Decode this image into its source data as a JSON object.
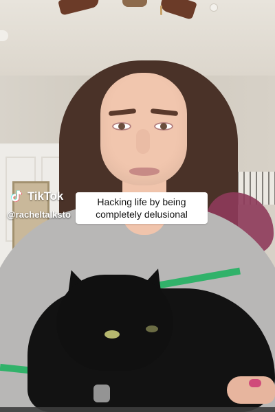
{
  "watermark": {
    "brand_name": "TikTok",
    "handle": "@racheltalksto",
    "logo_icon": "tiktok-logo-icon"
  },
  "caption": {
    "line1": "Hacking life by being",
    "line2": "completely delusional"
  },
  "colors": {
    "caption_bg": "#ffffff",
    "caption_text": "#111111",
    "watermark_text": "#ffffff",
    "sweater_stripe": "#31b26a",
    "hair_accent": "#a13a6b"
  }
}
